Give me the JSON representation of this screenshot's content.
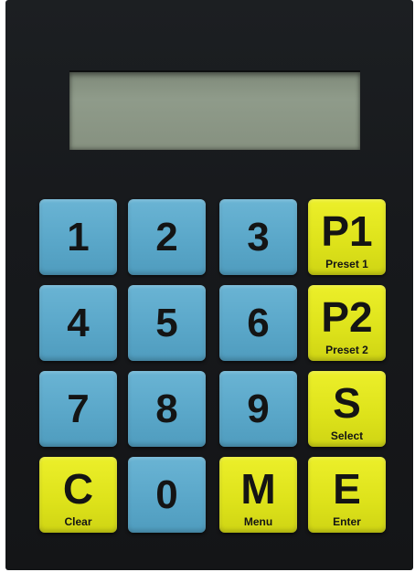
{
  "display": {
    "text": ""
  },
  "keys": [
    {
      "label": "1",
      "sublabel": "",
      "color": "blue"
    },
    {
      "label": "2",
      "sublabel": "",
      "color": "blue"
    },
    {
      "label": "3",
      "sublabel": "",
      "color": "blue"
    },
    {
      "label": "P1",
      "sublabel": "Preset 1",
      "color": "yellow"
    },
    {
      "label": "4",
      "sublabel": "",
      "color": "blue"
    },
    {
      "label": "5",
      "sublabel": "",
      "color": "blue"
    },
    {
      "label": "6",
      "sublabel": "",
      "color": "blue"
    },
    {
      "label": "P2",
      "sublabel": "Preset 2",
      "color": "yellow"
    },
    {
      "label": "7",
      "sublabel": "",
      "color": "blue"
    },
    {
      "label": "8",
      "sublabel": "",
      "color": "blue"
    },
    {
      "label": "9",
      "sublabel": "",
      "color": "blue"
    },
    {
      "label": "S",
      "sublabel": "Select",
      "color": "yellow"
    },
    {
      "label": "C",
      "sublabel": "Clear",
      "color": "yellow"
    },
    {
      "label": "0",
      "sublabel": "",
      "color": "blue"
    },
    {
      "label": "M",
      "sublabel": "Menu",
      "color": "yellow"
    },
    {
      "label": "E",
      "sublabel": "Enter",
      "color": "yellow"
    }
  ],
  "colors": {
    "panel": "#17191c",
    "key_blue": "#5aa7c9",
    "key_yellow": "#dde21a",
    "lcd": "#8a9585"
  }
}
